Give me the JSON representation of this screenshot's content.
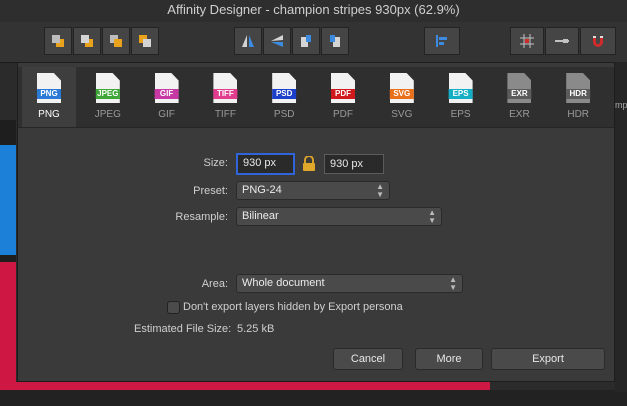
{
  "window": {
    "title": "Affinity Designer - champion stripes 930px (62.9%)"
  },
  "toolbar": {
    "groups": [
      [
        "arrange-back-icon",
        "arrange-backward-icon",
        "arrange-forward-icon",
        "arrange-front-icon"
      ],
      [
        "flip-horizontal-icon",
        "flip-vertical-icon",
        "rotate-left-icon",
        "rotate-right-icon"
      ],
      [
        "align-icon"
      ],
      [
        "snapping-grid-icon",
        "snapping-options-icon",
        "magnet-icon"
      ]
    ]
  },
  "side_panel": {
    "partial_text": "mpl"
  },
  "formats": [
    {
      "name": "PNG",
      "tag": "PNG",
      "color": "#2b7bd6",
      "selected": true
    },
    {
      "name": "JPEG",
      "tag": "JPEG",
      "color": "#3da837",
      "selected": false
    },
    {
      "name": "GIF",
      "tag": "GIF",
      "color": "#c639a5",
      "selected": false
    },
    {
      "name": "TIFF",
      "tag": "TIFF",
      "color": "#e03d8d",
      "selected": false
    },
    {
      "name": "PSD",
      "tag": "PSD",
      "color": "#1c3fc9",
      "selected": false
    },
    {
      "name": "PDF",
      "tag": "PDF",
      "color": "#d0191d",
      "selected": false
    },
    {
      "name": "SVG",
      "tag": "SVG",
      "color": "#e8701a",
      "selected": false
    },
    {
      "name": "EPS",
      "tag": "EPS",
      "color": "#13aec3",
      "selected": false
    },
    {
      "name": "EXR",
      "tag": "EXR",
      "color": "#5b5b5b",
      "selected": false
    },
    {
      "name": "HDR",
      "tag": "HDR",
      "color": "#5b5b5b",
      "selected": false
    }
  ],
  "export": {
    "size_label": "Size:",
    "width": "930 px",
    "height": "930 px",
    "preset_label": "Preset:",
    "preset": "PNG-24",
    "resample_label": "Resample:",
    "resample": "Bilinear",
    "area_label": "Area:",
    "area": "Whole document",
    "hidden_layers_label": "Don't export layers hidden by Export persona",
    "hidden_layers_checked": false,
    "file_size_label": "Estimated File Size:",
    "file_size": "5.25 kB"
  },
  "buttons": {
    "cancel": "Cancel",
    "more": "More",
    "export": "Export"
  }
}
